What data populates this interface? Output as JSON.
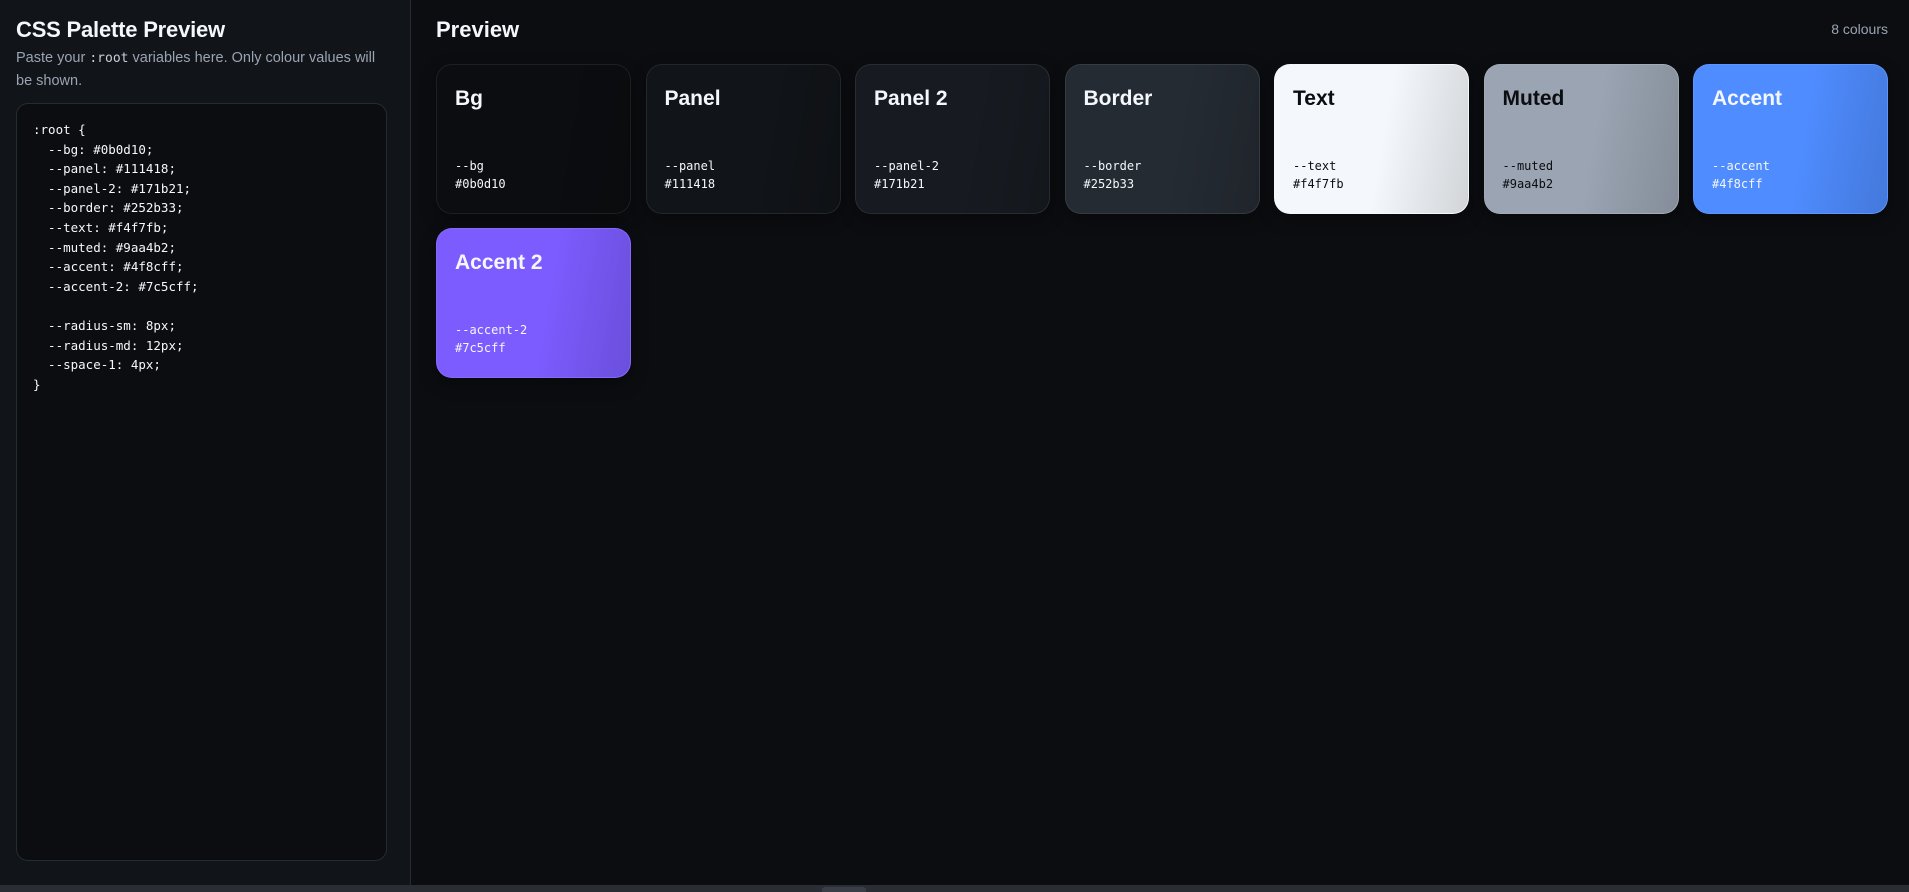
{
  "sidebar": {
    "title": "CSS Palette Preview",
    "hint_before": "Paste your ",
    "hint_code": ":root",
    "hint_after": " variables here. Only colour values will be shown.",
    "css_text": ":root {\n  --bg: #0b0d10;\n  --panel: #111418;\n  --panel-2: #171b21;\n  --border: #252b33;\n  --text: #f4f7fb;\n  --muted: #9aa4b2;\n  --accent: #4f8cff;\n  --accent-2: #7c5cff;\n\n  --radius-sm: 8px;\n  --radius-md: 12px;\n  --space-1: 4px;\n}"
  },
  "main": {
    "title": "Preview",
    "count_label": "8 colours"
  },
  "swatches": [
    {
      "name": "Bg",
      "var": "--bg",
      "hex": "#0b0d10",
      "bg": "#0b0d10",
      "fg": "#f4f7fb"
    },
    {
      "name": "Panel",
      "var": "--panel",
      "hex": "#111418",
      "bg": "#111418",
      "fg": "#f4f7fb"
    },
    {
      "name": "Panel 2",
      "var": "--panel-2",
      "hex": "#171b21",
      "bg": "#171b21",
      "fg": "#f4f7fb"
    },
    {
      "name": "Border",
      "var": "--border",
      "hex": "#252b33",
      "bg": "#252b33",
      "fg": "#f4f7fb"
    },
    {
      "name": "Text",
      "var": "--text",
      "hex": "#f4f7fb",
      "bg": "#f4f7fb",
      "fg": "#0b0d10"
    },
    {
      "name": "Muted",
      "var": "--muted",
      "hex": "#9aa4b2",
      "bg": "#9aa4b2",
      "fg": "#0b0d10"
    },
    {
      "name": "Accent",
      "var": "--accent",
      "hex": "#4f8cff",
      "bg": "#4f8cff",
      "fg": "#f4f7fb"
    },
    {
      "name": "Accent 2",
      "var": "--accent-2",
      "hex": "#7c5cff",
      "bg": "#7c5cff",
      "fg": "#f4f7fb"
    }
  ]
}
